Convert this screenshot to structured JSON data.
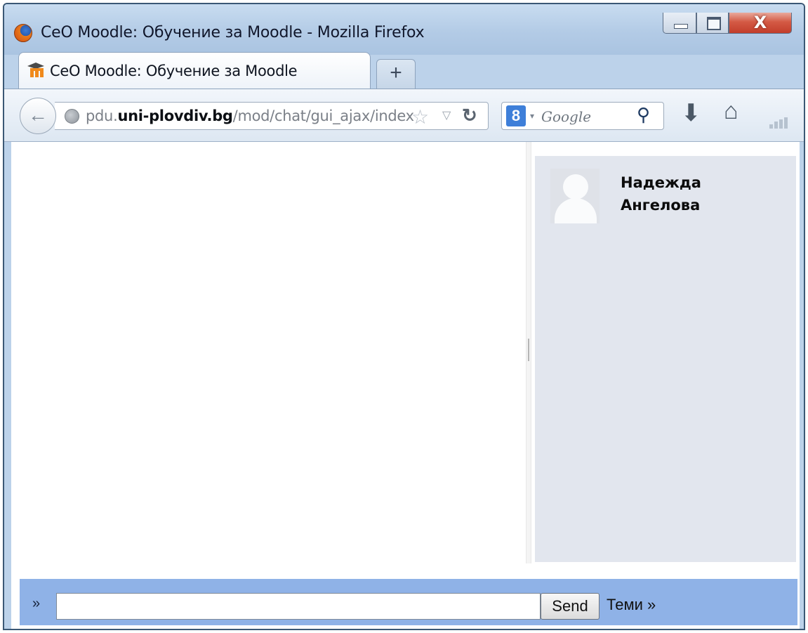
{
  "window": {
    "title": "CeO Moodle: Обучение за Moodle - Mozilla Firefox",
    "close_glyph": "X"
  },
  "tab": {
    "label": "CeO Moodle: Обучение за Moodle",
    "new_tab_glyph": "+"
  },
  "navbar": {
    "back_glyph": "←",
    "url_prefix": "pdu.",
    "url_host": "uni-plovdiv.bg",
    "url_path": "/mod/chat/gui_ajax/index.php",
    "star_glyph": "☆",
    "dropdown_glyph": "▽",
    "reload_glyph": "↻",
    "search_badge": "8",
    "search_dropdown_glyph": "▾",
    "search_placeholder": "Google",
    "magnifier_glyph": "⚲",
    "download_glyph": "⬇",
    "home_glyph": "⌂"
  },
  "chat": {
    "users": [
      {
        "name": "Надежда Ангелова",
        "avatar": "default-user-icon"
      }
    ],
    "prompt_marker": "»",
    "input_value": "",
    "send_label": "Send",
    "topics_label": "Теми »"
  },
  "colors": {
    "input_bar": "#8fb2e7",
    "user_panel": "#e2e6ee",
    "titlebar": "#b3cbe6"
  }
}
